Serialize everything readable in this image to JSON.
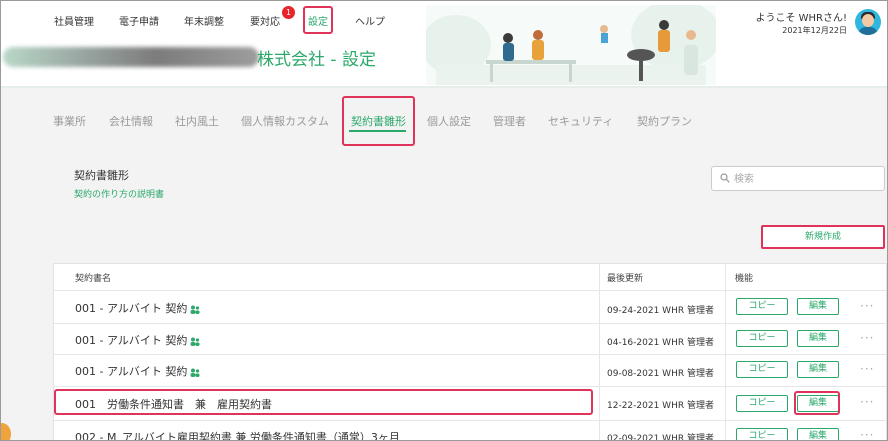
{
  "topnav": {
    "items": [
      "社員管理",
      "電子申請",
      "年末調整",
      "要対応",
      "設定",
      "ヘルプ"
    ],
    "badge": "1"
  },
  "user": {
    "welcome": "ようこそ WHRさん!",
    "date": "2021年12月22日"
  },
  "company": {
    "title": "株式会社 - 設定"
  },
  "tabs": [
    "事業所",
    "会社情報",
    "社内風土",
    "個人情報カスタム",
    "契約書雛形",
    "個人設定",
    "管理者",
    "セキュリティ",
    "契約プラン"
  ],
  "section": {
    "title": "契約書雛形",
    "link": "契約の作り方の説明書"
  },
  "search": {
    "placeholder": "検索"
  },
  "new_button": "新規作成",
  "table": {
    "headers": [
      "契約書名",
      "最後更新",
      "機能"
    ],
    "rows": [
      {
        "name": "001 - アルバイト 契約",
        "updated": "09-24-2021 WHR 管理者",
        "copy": "コピー",
        "edit": "編集",
        "more": "···"
      },
      {
        "name": "001 - アルバイト 契約",
        "updated": "04-16-2021 WHR 管理者",
        "copy": "コピー",
        "edit": "編集",
        "more": "···"
      },
      {
        "name": "001 - アルバイト 契約",
        "updated": "09-08-2021 WHR 管理者",
        "copy": "コピー",
        "edit": "編集",
        "more": "···"
      },
      {
        "name": "001　労働条件通知書　兼　雇用契約書",
        "updated": "12-22-2021 WHR 管理者",
        "copy": "コピー",
        "edit": "編集",
        "more": "···"
      },
      {
        "name": "002 - M_アルバイト雇用契約書 兼 労働条件通知書（通常）3ヶ月",
        "updated": "02-09-2021 WHR 管理者",
        "copy": "コピー",
        "edit": "編集",
        "more": "···"
      }
    ]
  },
  "colors": {
    "accent": "#2aa96b",
    "highlight": "#e0335a",
    "badge": "#e8232b"
  }
}
